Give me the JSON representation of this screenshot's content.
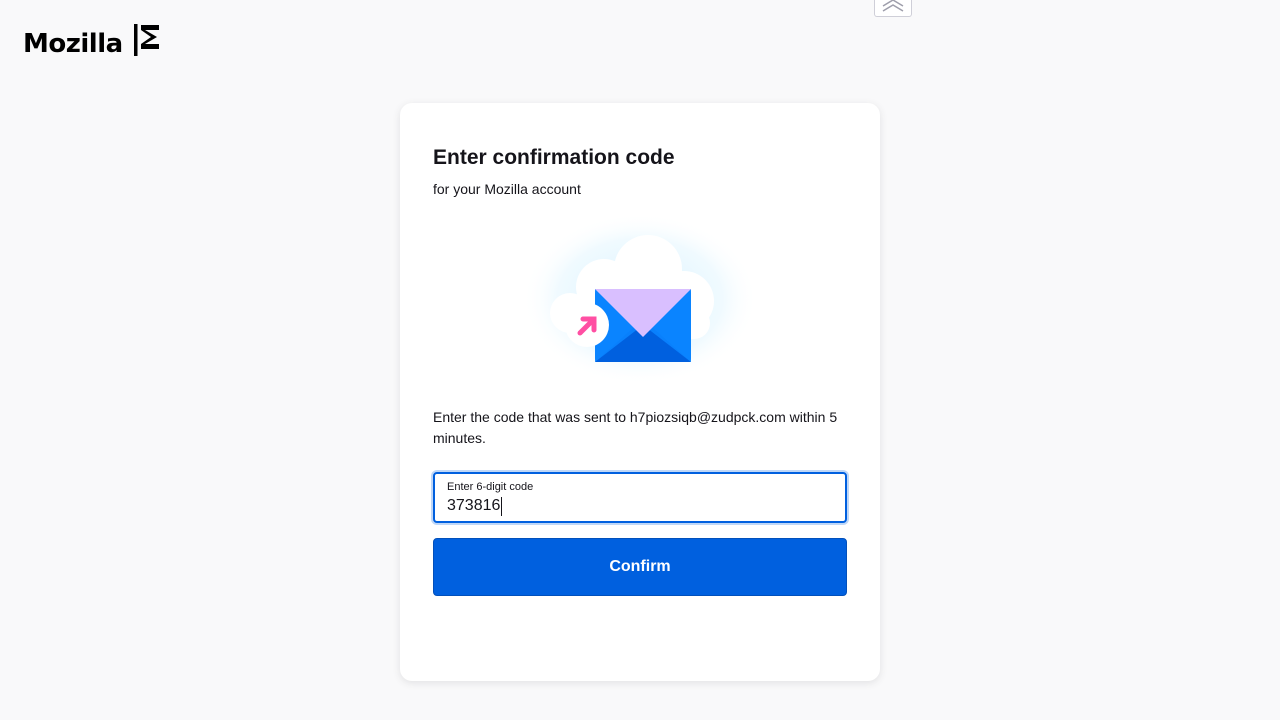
{
  "header": {
    "brand": "Mozilla"
  },
  "card": {
    "title": "Enter confirmation code",
    "subtitle": "for your Mozilla account",
    "description": "Enter the code that was sent to h7piozsiqb@zudpck.com within 5 minutes.",
    "code_field": {
      "label": "Enter 6-digit code",
      "value": "373816"
    },
    "confirm_label": "Confirm"
  },
  "colors": {
    "accent": "#0060df",
    "background": "#f9f9fa",
    "envelope_flap": "#d9bfff",
    "envelope_body": "#0a84ff",
    "arrow": "#ff4fa3"
  },
  "icons": {
    "logo": "mozilla-m-icon",
    "top_tab": "double-chevron-up-icon",
    "illustration": "envelope-cloud-icon"
  }
}
